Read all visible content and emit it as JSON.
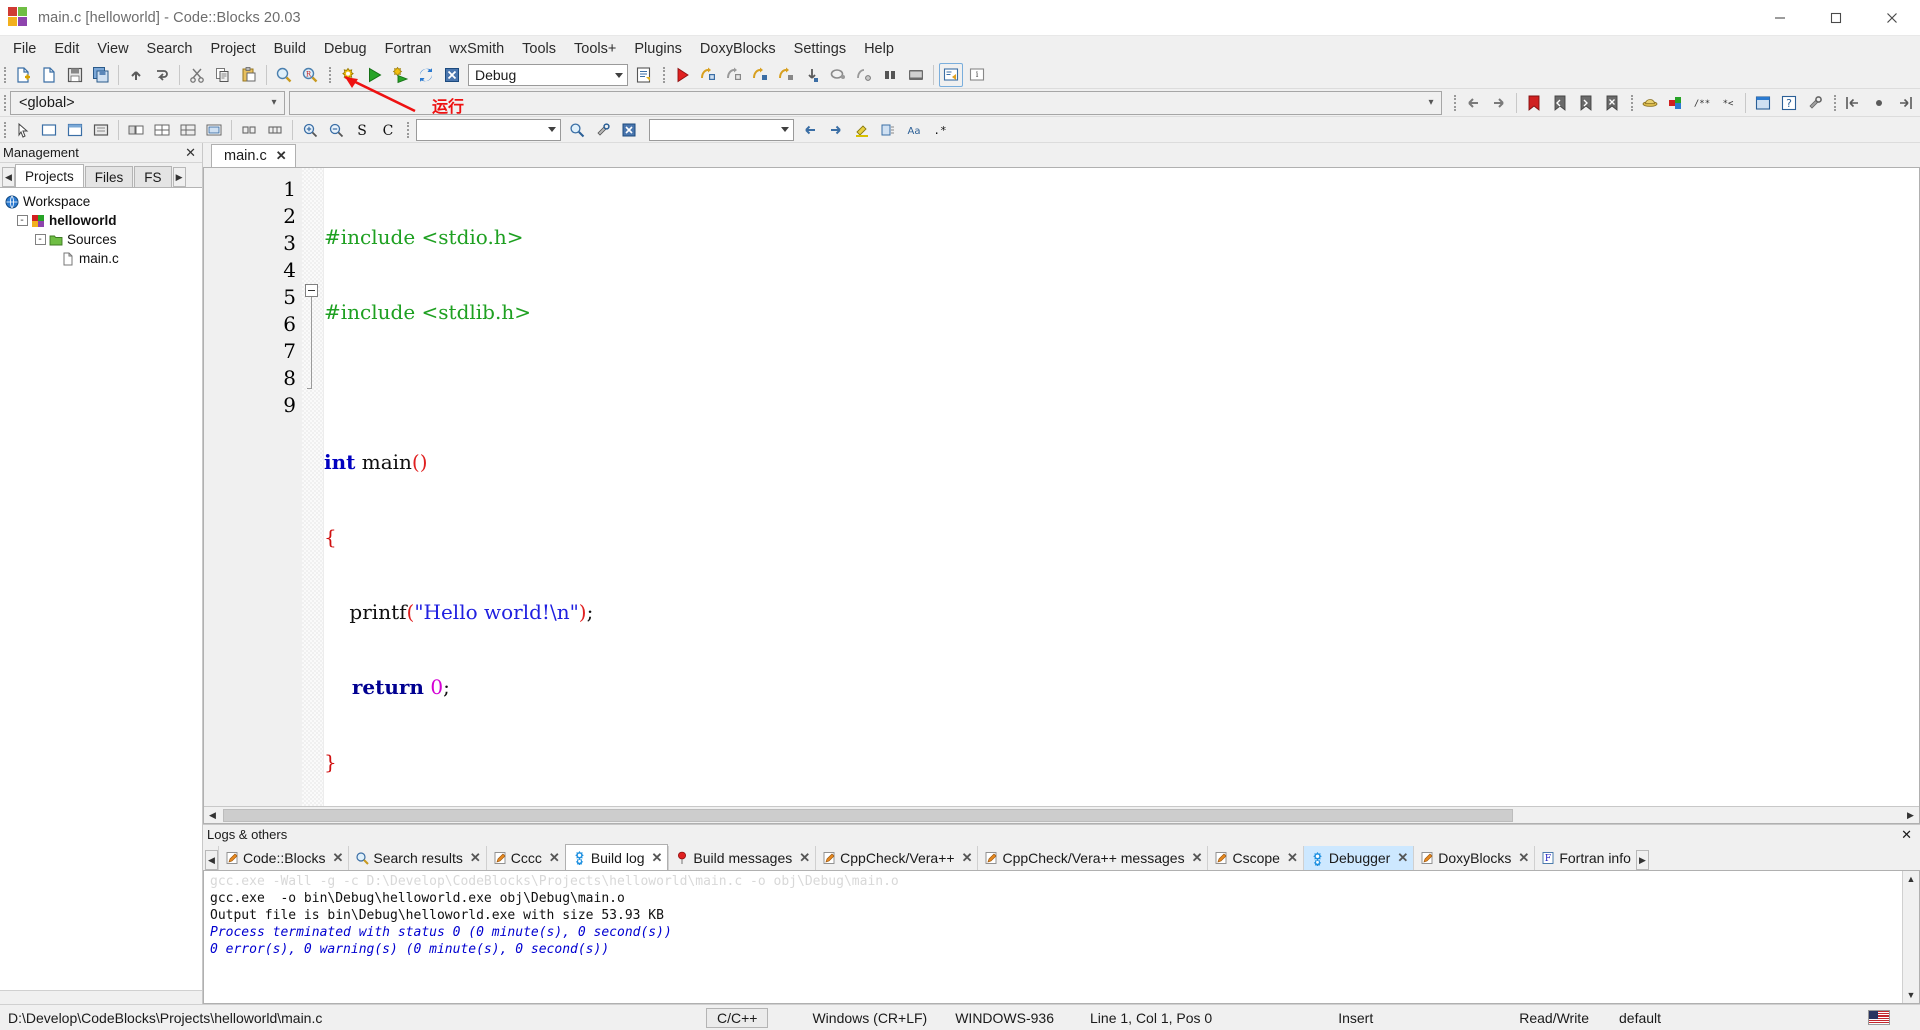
{
  "window": {
    "title": "main.c [helloworld] - Code::Blocks 20.03",
    "minimize_label": "—",
    "maximize_label": "☐",
    "close_label": "✕"
  },
  "menubar": {
    "items": [
      "File",
      "Edit",
      "View",
      "Search",
      "Project",
      "Build",
      "Debug",
      "Fortran",
      "wxSmith",
      "Tools",
      "Tools+",
      "Plugins",
      "DoxyBlocks",
      "Settings",
      "Help"
    ]
  },
  "toolbar_main": {
    "buttons": [
      {
        "name": "new-file",
        "icon": "new-file-icon"
      },
      {
        "name": "open-file",
        "icon": "open-file-icon"
      },
      {
        "name": "save",
        "icon": "save-icon"
      },
      {
        "name": "save-all",
        "icon": "save-all-icon"
      },
      {
        "name": "undo",
        "icon": "undo-icon"
      },
      {
        "name": "redo",
        "icon": "redo-icon"
      },
      {
        "name": "cut",
        "icon": "cut-icon"
      },
      {
        "name": "copy",
        "icon": "copy-icon"
      },
      {
        "name": "paste",
        "icon": "paste-icon"
      },
      {
        "name": "find",
        "icon": "find-icon"
      },
      {
        "name": "replace",
        "icon": "replace-icon"
      }
    ],
    "build_buttons": [
      {
        "name": "build",
        "icon": "build-gear-icon"
      },
      {
        "name": "run",
        "icon": "run-green-arrow-icon"
      },
      {
        "name": "build-and-run",
        "icon": "build-and-run-icon"
      },
      {
        "name": "rebuild",
        "icon": "rebuild-icon"
      },
      {
        "name": "abort",
        "icon": "abort-icon"
      }
    ],
    "target_combo": {
      "value": "Debug",
      "placeholder": "Debug"
    },
    "show_build_targets": {
      "name": "build-log-icon"
    },
    "debug_buttons": [
      {
        "name": "debug-continue",
        "icon": "debug-red-arrow-icon"
      },
      {
        "name": "run-to-cursor",
        "icon": "run-to-cursor-icon"
      },
      {
        "name": "next-line",
        "icon": "next-line-icon"
      },
      {
        "name": "step-into",
        "icon": "step-into-icon"
      },
      {
        "name": "step-out",
        "icon": "step-out-icon"
      },
      {
        "name": "next-instruction",
        "icon": "next-instruction-icon"
      },
      {
        "name": "step-into-instruction",
        "icon": "step-into-instruction-icon"
      },
      {
        "name": "break-debugger",
        "icon": "break-debugger-icon"
      },
      {
        "name": "stop-debugger",
        "icon": "stop-debugger-icon"
      },
      {
        "name": "debugging-windows",
        "icon": "debugging-windows-icon"
      },
      {
        "name": "various-info",
        "icon": "various-info-icon"
      }
    ]
  },
  "toolbar_second": {
    "scope_combo": {
      "value": "<global>"
    },
    "function_combo": {
      "value": ""
    },
    "nav_buttons": [
      {
        "name": "back",
        "icon": "arrow-left-icon"
      },
      {
        "name": "forward",
        "icon": "arrow-right-icon"
      },
      {
        "name": "toggle-bookmark",
        "icon": "bookmark-red-icon"
      },
      {
        "name": "previous-bookmark",
        "icon": "bookmark-prev-icon"
      },
      {
        "name": "next-bookmark",
        "icon": "bookmark-next-icon"
      },
      {
        "name": "clear-bookmarks",
        "icon": "bookmark-clear-icon"
      }
    ],
    "doxy_buttons": [
      {
        "name": "doxyblocks-extract",
        "icon": "doxy-hat-icon"
      },
      {
        "name": "doxyblocks-run",
        "icon": "doxy-blocks-icon"
      },
      {
        "name": "doxyblocks-comment",
        "icon": "doxy-comment-icon"
      },
      {
        "name": "doxyblocks-block-comment",
        "icon": "doxy-block-comment-icon"
      },
      {
        "name": "doxyblocks-wizard",
        "icon": "doxy-wizard-icon"
      },
      {
        "name": "doxyblocks-help",
        "icon": "doxy-help-icon"
      },
      {
        "name": "doxyblocks-config",
        "icon": "doxy-config-icon"
      }
    ],
    "fortran_buttons": [
      {
        "name": "fortran-jump-back",
        "icon": "jump-back-icon"
      },
      {
        "name": "fortran-jump-home",
        "icon": "jump-home-icon"
      },
      {
        "name": "fortran-jump-forward",
        "icon": "jump-forward-icon"
      }
    ]
  },
  "toolbar_third": {
    "buttons": [
      {
        "name": "select-tool",
        "icon": "arrow-cursor-icon"
      },
      {
        "name": "insert-dialog",
        "icon": "dialog-icon"
      },
      {
        "name": "insert-frame",
        "icon": "frame-icon"
      },
      {
        "name": "insert-panel",
        "icon": "panel-icon"
      },
      {
        "name": "box-sizer",
        "icon": "box-sizer-icon"
      },
      {
        "name": "grid-sizer",
        "icon": "grid-sizer-icon"
      },
      {
        "name": "flex-grid-sizer",
        "icon": "flex-grid-icon"
      },
      {
        "name": "static-box-sizer",
        "icon": "static-box-icon"
      },
      {
        "name": "spacer",
        "icon": "spacer-icon"
      },
      {
        "name": "stretch-spacer",
        "icon": "stretch-spacer-icon"
      },
      {
        "name": "zoom-in",
        "icon": "zoom-in-icon"
      },
      {
        "name": "zoom-out",
        "icon": "zoom-out-icon"
      },
      {
        "name": "symbol-s",
        "icon": "letter-s-icon"
      },
      {
        "name": "symbol-c",
        "icon": "letter-c-icon"
      }
    ],
    "search_combo": {
      "value": "",
      "placeholder": ""
    },
    "search_go": {
      "name": "search-go-icon"
    },
    "search_options": {
      "name": "search-options-icon"
    },
    "clear_button": {
      "name": "clear-x-icon"
    },
    "second_combo": {
      "value": "",
      "placeholder": ""
    },
    "right_buttons": [
      {
        "name": "prev-result",
        "icon": "arrow-left-blue-icon"
      },
      {
        "name": "next-result",
        "icon": "arrow-right-blue-icon"
      },
      {
        "name": "highlight",
        "icon": "highlight-pen-icon"
      },
      {
        "name": "selected-only",
        "icon": "selected-only-icon"
      },
      {
        "name": "match-case",
        "icon": "match-case-icon"
      },
      {
        "name": "regex",
        "icon": "regex-icon"
      }
    ]
  },
  "annotation": {
    "label": "运行",
    "color": "#ee1111"
  },
  "management": {
    "title": "Management",
    "close_label": "✕",
    "tabs": [
      {
        "label": "Projects",
        "active": true
      },
      {
        "label": "Files",
        "active": false
      },
      {
        "label": "FS",
        "active": false
      }
    ],
    "nav_prev": "◀",
    "nav_next": "▶",
    "tree": [
      {
        "label": "Workspace",
        "depth": 0,
        "icon": "workspace-icon",
        "expander": "",
        "bold": false
      },
      {
        "label": "helloworld",
        "depth": 1,
        "icon": "project-icon",
        "expander": "-",
        "bold": true
      },
      {
        "label": "Sources",
        "depth": 2,
        "icon": "folder-icon",
        "expander": "-",
        "bold": false
      },
      {
        "label": "main.c",
        "depth": 3,
        "icon": "file-icon",
        "expander": "",
        "bold": false
      }
    ]
  },
  "editor": {
    "tabs": [
      {
        "label": "main.c",
        "close": "✕",
        "active": true
      }
    ],
    "line_numbers": [
      "1",
      "2",
      "3",
      "4",
      "5",
      "6",
      "7",
      "8",
      "9"
    ],
    "code_lines": [
      {
        "n": 1,
        "tokens": [
          {
            "t": "#include <stdio.h>",
            "c": "k-pre"
          }
        ]
      },
      {
        "n": 2,
        "tokens": [
          {
            "t": "#include <stdlib.h>",
            "c": "k-pre"
          }
        ]
      },
      {
        "n": 3,
        "tokens": [
          {
            "t": "",
            "c": "k-op"
          }
        ]
      },
      {
        "n": 4,
        "tokens": [
          {
            "t": "int",
            "c": "k-type"
          },
          {
            "t": " main",
            "c": "k-fn"
          },
          {
            "t": "()",
            "c": "k-par"
          }
        ]
      },
      {
        "n": 5,
        "tokens": [
          {
            "t": "{",
            "c": "k-brace"
          }
        ]
      },
      {
        "n": 6,
        "tokens": [
          {
            "t": "    printf",
            "c": "k-fn"
          },
          {
            "t": "(",
            "c": "k-par"
          },
          {
            "t": "\"Hello world!\\n\"",
            "c": "k-str"
          },
          {
            "t": ")",
            "c": "k-par"
          },
          {
            "t": ";",
            "c": "k-op"
          }
        ]
      },
      {
        "n": 7,
        "tokens": [
          {
            "t": "    return",
            "c": "k-kw"
          },
          {
            "t": " 0",
            "c": "k-num"
          },
          {
            "t": ";",
            "c": "k-op"
          }
        ]
      },
      {
        "n": 8,
        "tokens": [
          {
            "t": "}",
            "c": "k-brace"
          }
        ]
      },
      {
        "n": 9,
        "tokens": [
          {
            "t": "",
            "c": "k-op"
          }
        ]
      }
    ]
  },
  "logs": {
    "title": "Logs & others",
    "close_label": "✕",
    "nav_prev": "◀",
    "nav_next": "▶",
    "tabs": [
      {
        "label": "Code::Blocks",
        "icon": "pencil-icon",
        "state": "normal"
      },
      {
        "label": "Search results",
        "icon": "magnifier-icon",
        "state": "normal"
      },
      {
        "label": "Cccc",
        "icon": "pencil-icon",
        "state": "normal"
      },
      {
        "label": "Build log",
        "icon": "gear-blue-icon",
        "state": "active"
      },
      {
        "label": "Build messages",
        "icon": "pin-red-icon",
        "state": "normal"
      },
      {
        "label": "CppCheck/Vera++",
        "icon": "pencil-icon",
        "state": "normal"
      },
      {
        "label": "CppCheck/Vera++ messages",
        "icon": "pencil-icon",
        "state": "normal"
      },
      {
        "label": "Cscope",
        "icon": "pencil-icon",
        "state": "normal"
      },
      {
        "label": "Debugger",
        "icon": "gear-blue-icon",
        "state": "selected"
      },
      {
        "label": "DoxyBlocks",
        "icon": "pencil-icon",
        "state": "normal"
      },
      {
        "label": "Fortran info",
        "icon": "letter-f-icon",
        "state": "normal"
      }
    ],
    "build_output": [
      {
        "text": "gcc.exe -Wall -g -c D:\\Develop\\CodeBlocks\\Projects\\helloworld\\main.c -o obj\\Debug\\main.o",
        "style": "cut"
      },
      {
        "text": "gcc.exe  -o bin\\Debug\\helloworld.exe obj\\Debug\\main.o",
        "style": "plain"
      },
      {
        "text": "Output file is bin\\Debug\\helloworld.exe with size 53.93 KB",
        "style": "plain"
      },
      {
        "text": "Process terminated with status 0 (0 minute(s), 0 second(s))",
        "style": "blue"
      },
      {
        "text": "0 error(s), 0 warning(s) (0 minute(s), 0 second(s))",
        "style": "blue"
      }
    ]
  },
  "statusbar": {
    "path": "D:\\Develop\\CodeBlocks\\Projects\\helloworld\\main.c",
    "language": "C/C++",
    "eol": "Windows (CR+LF)",
    "encoding": "WINDOWS-936",
    "cursor": "Line 1, Col 1, Pos 0",
    "insert_mode": "Insert",
    "access": "Read/Write",
    "profile": "default",
    "flag": "us-flag-icon"
  }
}
